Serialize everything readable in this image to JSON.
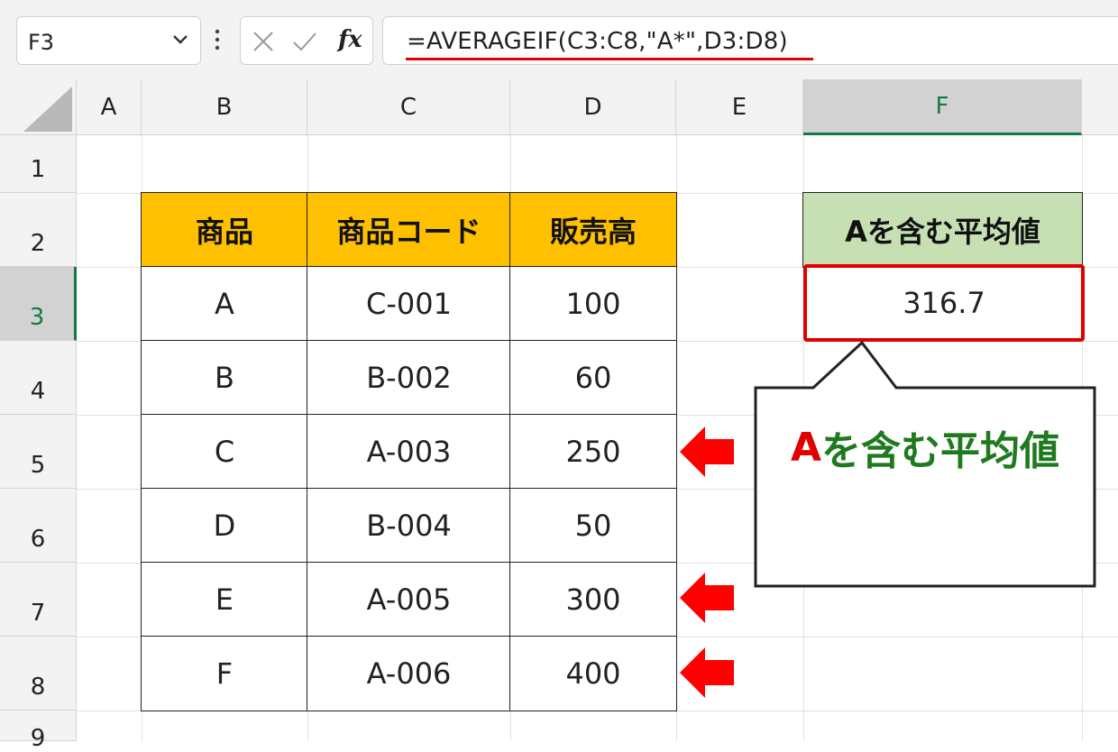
{
  "formula_bar": {
    "name_box": "F3",
    "fx_label": "fx",
    "formula": "=AVERAGEIF(C3:C8,\"A*\",D3:D8)"
  },
  "columns": [
    "A",
    "B",
    "C",
    "D",
    "E",
    "F"
  ],
  "rows": [
    "1",
    "2",
    "3",
    "4",
    "5",
    "6",
    "7",
    "8",
    "9"
  ],
  "table": {
    "headers": [
      "商品",
      "商品コード",
      "販売高"
    ],
    "rows": [
      [
        "A",
        "C-001",
        "100"
      ],
      [
        "B",
        "B-002",
        "60"
      ],
      [
        "C",
        "A-003",
        "250"
      ],
      [
        "D",
        "B-004",
        "50"
      ],
      [
        "E",
        "A-005",
        "300"
      ],
      [
        "F",
        "A-006",
        "400"
      ]
    ]
  },
  "result": {
    "header": "Aを含む平均値",
    "value": "316.7"
  },
  "callout": {
    "prefix": "A",
    "rest": "を含む平均値"
  },
  "colors": {
    "table_header": "#ffc000",
    "result_header": "#c6e0b4",
    "highlight": "#e00000",
    "callout_text": "#1e7a1e",
    "selection": "#107c41"
  }
}
